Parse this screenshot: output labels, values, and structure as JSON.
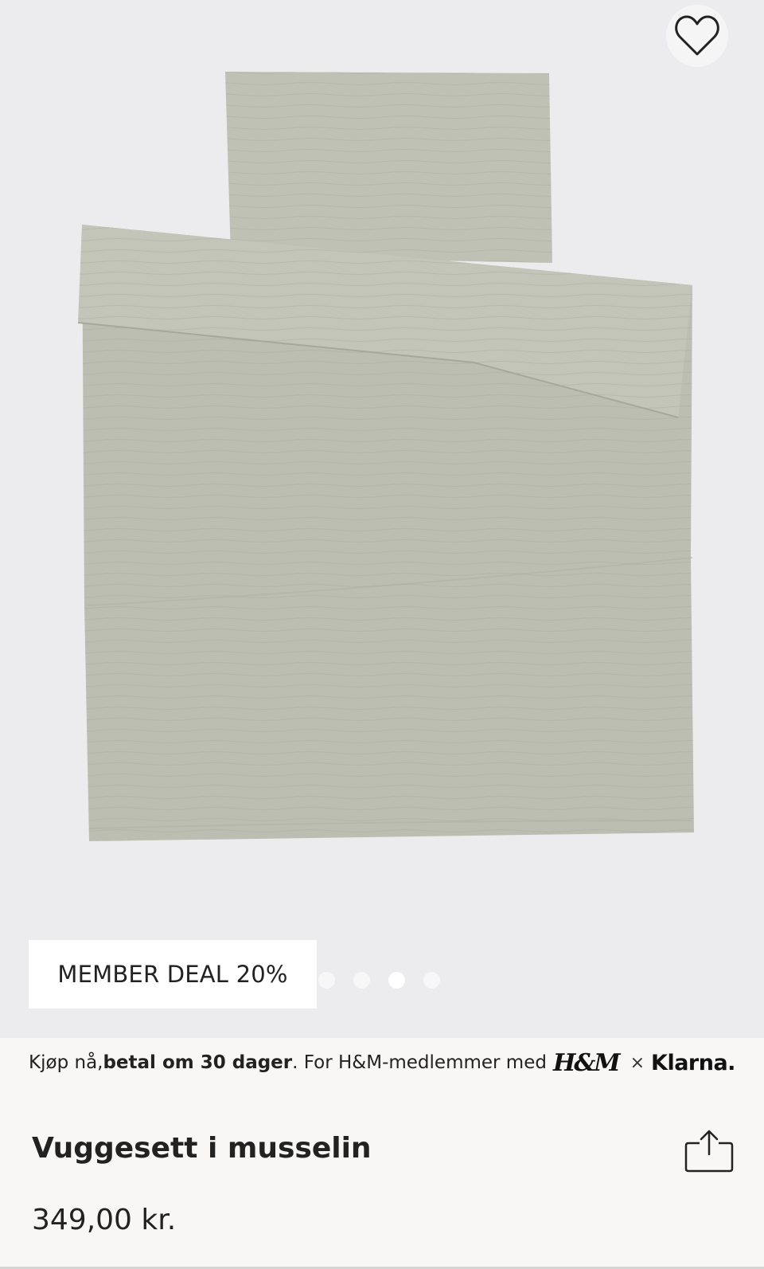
{
  "product": {
    "image_alt": "Vuggesett i musselin",
    "color": "#bdbfb2"
  },
  "favorite": {
    "icon": "heart-outline-icon"
  },
  "badge": {
    "label": "MEMBER DEAL 20%"
  },
  "gallery": {
    "dot_count": 4,
    "active_index": 2
  },
  "klarna_bar": {
    "part1": "Kjøp nå, ",
    "part2_bold": "betal om 30 dager",
    "part3": ". For H&M-medlemmer med ",
    "hm_logo": "H&M",
    "times": "×",
    "klarna_logo": "Klarna."
  },
  "details": {
    "title": "Vuggesett i musselin",
    "price": "349,00 kr.",
    "share_icon": "share-icon"
  }
}
